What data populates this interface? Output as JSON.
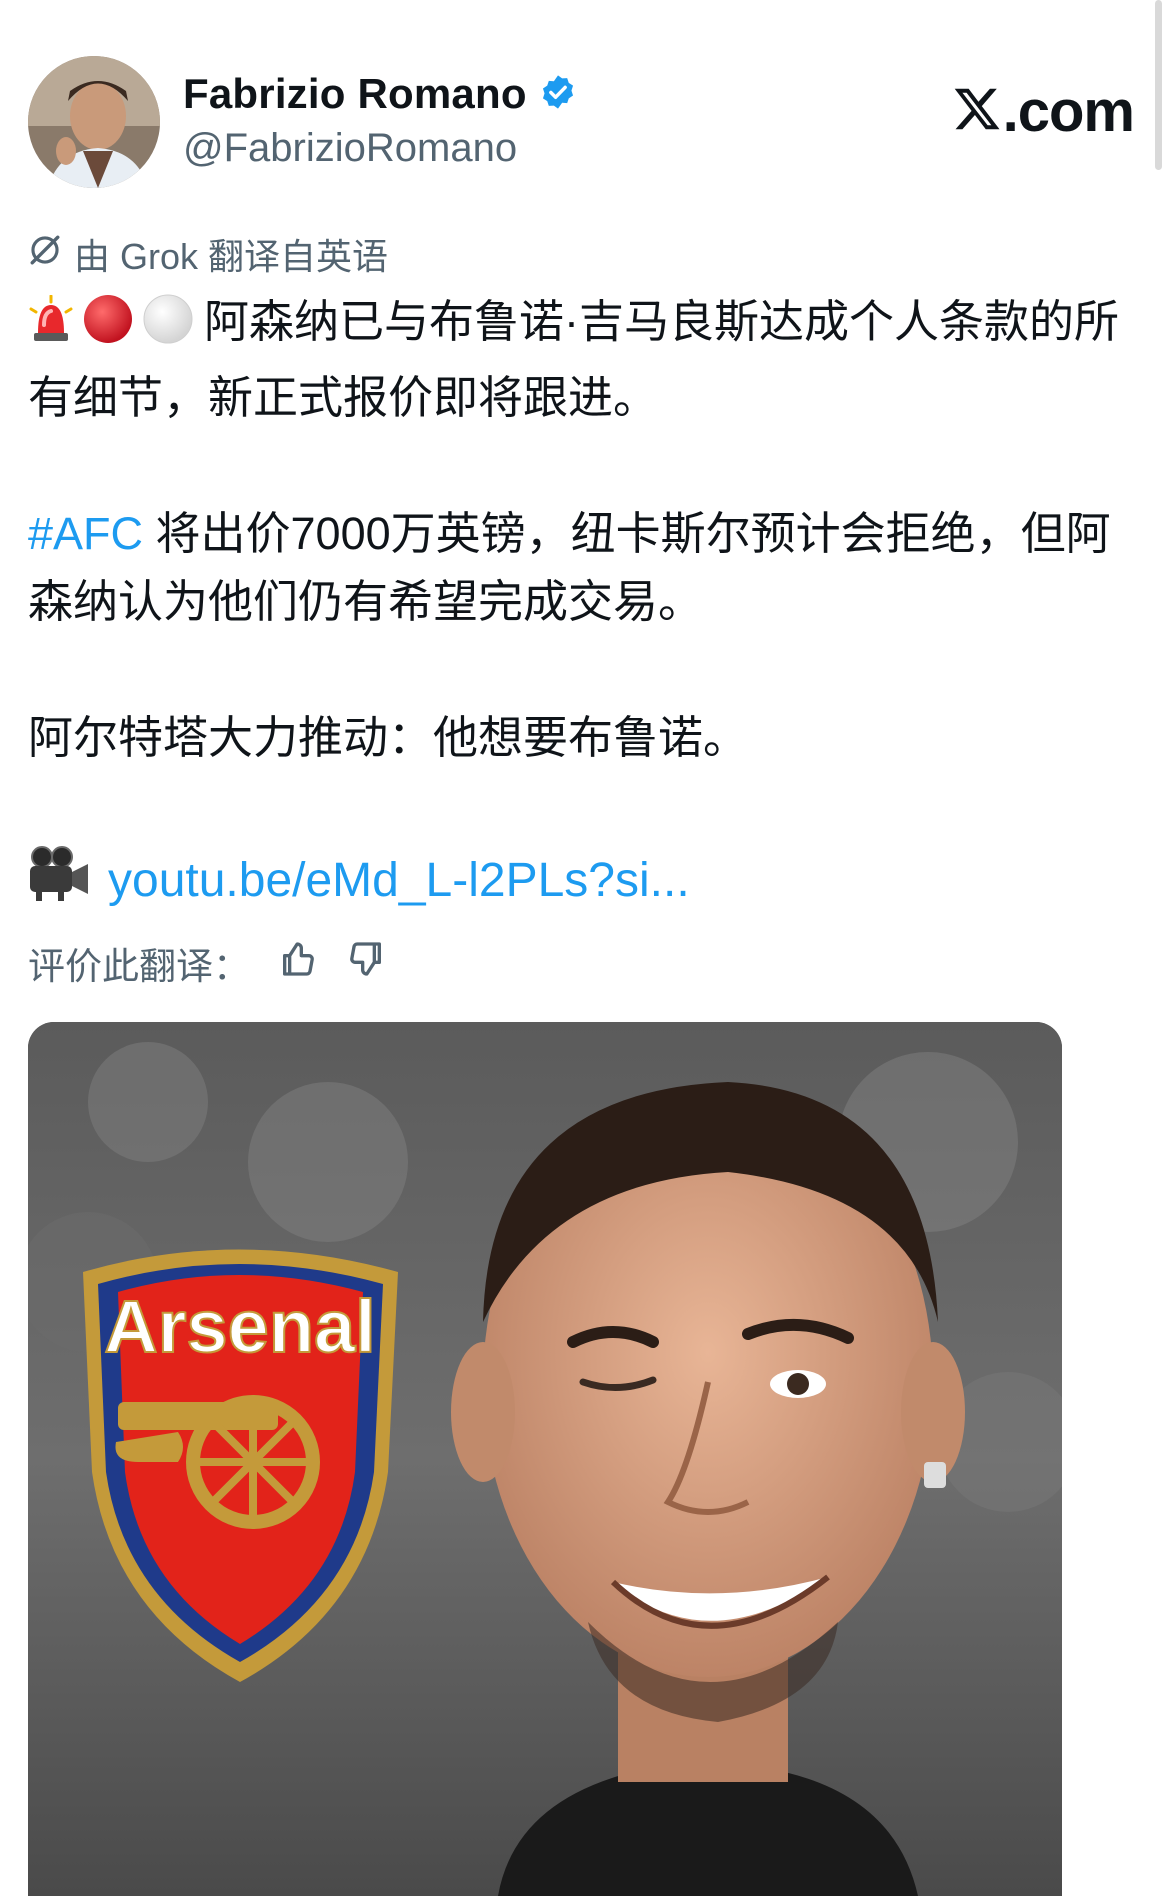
{
  "author": {
    "display_name": "Fabrizio Romano",
    "handle": "@FabrizioRomano",
    "verified": true
  },
  "brand": {
    "x_dotcom": ".com"
  },
  "translation": {
    "note": "由 Grok 翻译自英语",
    "rate_label": "评价此翻译："
  },
  "tweet": {
    "line1": "阿森纳已与布鲁诺·吉马良斯达成个人条款的所有细节，新正式报价即将跟进。",
    "hashtag": "#AFC",
    "line2_rest": " 将出价7000万英镑，纽卡斯尔预计会拒绝，但阿森纳认为他们仍有希望完成交易。",
    "line3": "阿尔特塔大力推动：他想要布鲁诺。",
    "link": "youtu.be/eMd_L-l2PLs?si..."
  },
  "media": {
    "crest_text": "Arsenal"
  },
  "colors": {
    "link_blue": "#1d9bf0",
    "secondary_text": "#536471",
    "arsenal_red": "#e2231a",
    "arsenal_gold": "#c49a3a",
    "arsenal_navy": "#1f3a8a"
  }
}
